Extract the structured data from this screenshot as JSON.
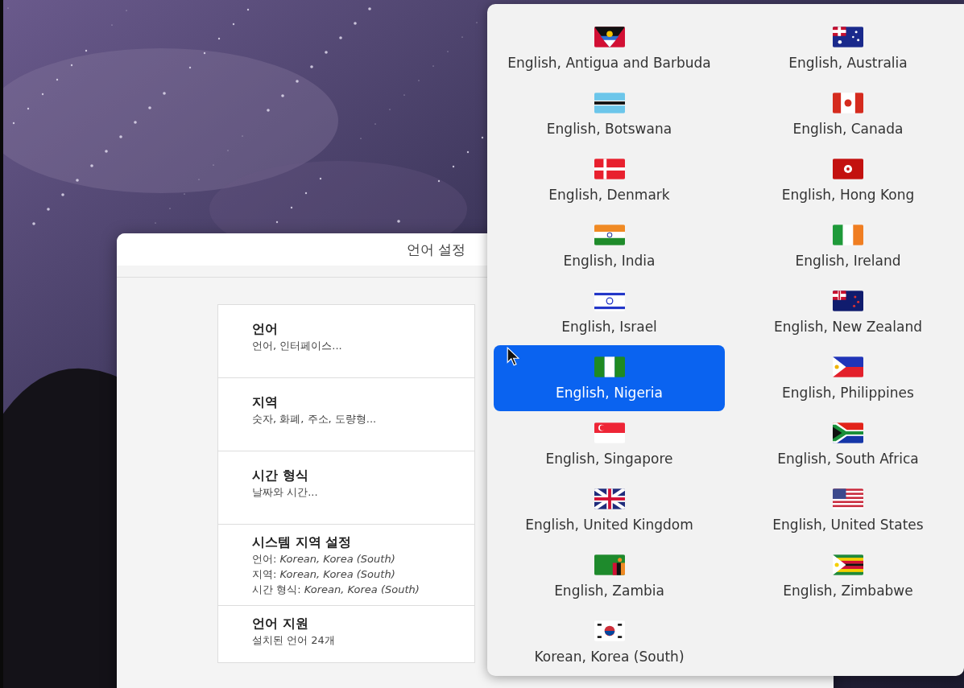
{
  "window": {
    "title": "언어 설정"
  },
  "settings": [
    {
      "title": "언어",
      "lines": [
        "언어, 인터페이스..."
      ]
    },
    {
      "title": "지역",
      "lines": [
        "숫자, 화폐, 주소, 도량형..."
      ]
    },
    {
      "title": "시간 형식",
      "lines": [
        "날짜와 시간..."
      ]
    },
    {
      "title": "시스템 지역 설정",
      "lines": [
        "언어: *Korean, Korea (South)*",
        "지역: *Korean, Korea (South)*",
        "시간 형식: *Korean, Korea (South)*"
      ]
    },
    {
      "title": "언어 지원",
      "lines": [
        "설치된 언어 24개"
      ]
    }
  ],
  "locales": [
    {
      "label": "English, Antigua and Barbuda",
      "selected": false
    },
    {
      "label": "English, Australia",
      "selected": false
    },
    {
      "label": "English, Botswana",
      "selected": false
    },
    {
      "label": "English, Canada",
      "selected": false
    },
    {
      "label": "English, Denmark",
      "selected": false
    },
    {
      "label": "English, Hong Kong",
      "selected": false
    },
    {
      "label": "English, India",
      "selected": false
    },
    {
      "label": "English, Ireland",
      "selected": false
    },
    {
      "label": "English, Israel",
      "selected": false
    },
    {
      "label": "English, New Zealand",
      "selected": false
    },
    {
      "label": "English, Nigeria",
      "selected": true
    },
    {
      "label": "English, Philippines",
      "selected": false
    },
    {
      "label": "English, Singapore",
      "selected": false
    },
    {
      "label": "English, South Africa",
      "selected": false
    },
    {
      "label": "English, United Kingdom",
      "selected": false
    },
    {
      "label": "English, United States",
      "selected": false
    },
    {
      "label": "English, Zambia",
      "selected": false
    },
    {
      "label": "English, Zimbabwe",
      "selected": false
    },
    {
      "label": "Korean, Korea (South)",
      "selected": false
    }
  ]
}
